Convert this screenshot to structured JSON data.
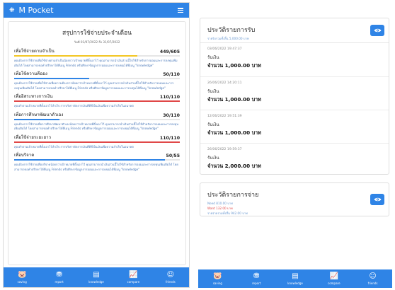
{
  "app": {
    "title": "M Pocket"
  },
  "summary": {
    "title": "สรุปการใช้จ่ายประจำเดือน",
    "range": "วันที่ 01/07/2022 ถึง 31/07/2022",
    "categories": [
      {
        "name": "เพื่อใช้จ่ายตามจำเป็น",
        "value": "449/605",
        "fraction": 0.742,
        "color": "#f3c623",
        "desc": "คุณต้องการใช้จ่ายเพื่อใช้จ่ายตามจำเป็นน้อยกว่าเป้าหมายที่ตั้งเอาไว้ คุณสามารถนำเงินส่วนนี้ไปใช้สำหรับการออมและการลงทุนเพิ่มเติมได้ โดยสามารถขอคำปรึกษาได้ที่เมนู Friends หรือศึกษาข้อมูลการออมและการลงทุนได้ที่เมนู \"knowledge\""
      },
      {
        "name": "เพื่อใช้ความคืออง",
        "value": "50/110",
        "fraction": 0.455,
        "color": "#2f84e6",
        "desc": "คุณต้องการใช้จ่ายเพื่อใช้จ่ายเพื่อความต้องการน้อยกว่าเป้าหมายที่ตั้งเอาไว้ คุณสามารถนำเงินส่วนนี้ไปใช้สำหรับการออมและการลงทุนเพิ่มเติมได้ โดยสามารถขอคำปรึกษาได้ที่เมนู Friends หรือศึกษาข้อมูลการออมและการลงทุนได้ที่เมนู \"knowledge\""
      },
      {
        "name": "เพื่ออิสระทางการเงิน",
        "value": "110/110",
        "fraction": 1.0,
        "color": "#e04848",
        "desc": "คุณทำตามเป้าหมายที่ตั้งเอาไว้สำเร็จ การบริหารจัดการเงินที่ดีที่เป็นเงินเพื่อความสำเร็จในอนาคต"
      },
      {
        "name": "เพื่อการศึกษาพัฒนาตัวเอง",
        "value": "30/110",
        "fraction": 0.273,
        "color": "#2f84e6",
        "desc": "คุณต้องการใช้จ่ายเพื่อการศึกษาพัฒนาตัวเองน้อยกว่าเป้าหมายที่ตั้งเอาไว้ คุณสามารถนำเงินส่วนนี้ไปใช้สำหรับการออมและการลงทุนเพิ่มเติมได้ โดยสามารถขอคำปรึกษาได้ที่เมนู Friends หรือศึกษาข้อมูลการออมและการลงทุนได้ที่เมนู \"knowledge\""
      },
      {
        "name": "เพื่อใช้จ่ายระยะยาว",
        "value": "110/110",
        "fraction": 1.0,
        "color": "#e04848",
        "desc": "คุณทำตามเป้าหมายที่ตั้งเอาไว้สำเร็จ การบริหารจัดการเงินที่ดีที่เป็นเงินเพื่อความสำเร็จในอนาคต"
      },
      {
        "name": "เพื่อบริจาค",
        "value": "50/55",
        "fraction": 0.909,
        "color": "#2f84e6",
        "desc": "คุณต้องการใช้จ่ายเพื่อบริจาคน้อยกว่าเป้าหมายที่ตั้งเอาไว้ คุณสามารถนำเงินส่วนนี้ไปใช้สำหรับการออมและการลงทุนเพิ่มเติมได้ โดยสามารถขอคำปรึกษาได้ที่เมนู Friends หรือศึกษาข้อมูลการออมและการลงทุนได้ที่เมนู \"knowledge\""
      }
    ]
  },
  "tabs": [
    {
      "label": "saving",
      "icon": "piggy-bank-icon",
      "glyph": "🐷"
    },
    {
      "label": "report",
      "icon": "coins-icon",
      "glyph": "⛃"
    },
    {
      "label": "knowledge",
      "icon": "book-icon",
      "glyph": "▤"
    },
    {
      "label": "compare",
      "icon": "chart-icon",
      "glyph": "📈"
    },
    {
      "label": "friends",
      "icon": "contact-book-icon",
      "glyph": "☺"
    }
  ],
  "income": {
    "title": "ประวัติรายการรับ",
    "subtitle": "รายรับรวมทั้งสิ้น 5,000.00 บาท",
    "transactions": [
      {
        "date": "03/06/2022 19:47:37",
        "type": "รับเงิน",
        "amount": "จำนวน 1,000.00 บาท"
      },
      {
        "date": "26/06/2022 14:20:11",
        "type": "รับเงิน",
        "amount": "จำนวน 1,000.00 บาท"
      },
      {
        "date": "12/06/2022 19:51:39",
        "type": "รับเงิน",
        "amount": "จำนวน 1,000.00 บาท"
      },
      {
        "date": "26/06/2022 19:59:37",
        "type": "รับเงิน",
        "amount": "จำนวน 2,000.00 บาท"
      }
    ]
  },
  "expense": {
    "title": "ประวัติรายการจ่าย",
    "need": "Need 810.00 บาท",
    "want": "Want 132.00 บาท",
    "total": "รายจ่ายรวมทั้งสิ้น 942.00 บาท"
  },
  "colors": {
    "primary": "#2f84e6",
    "warn": "#e04848",
    "accent": "#f3c623"
  }
}
